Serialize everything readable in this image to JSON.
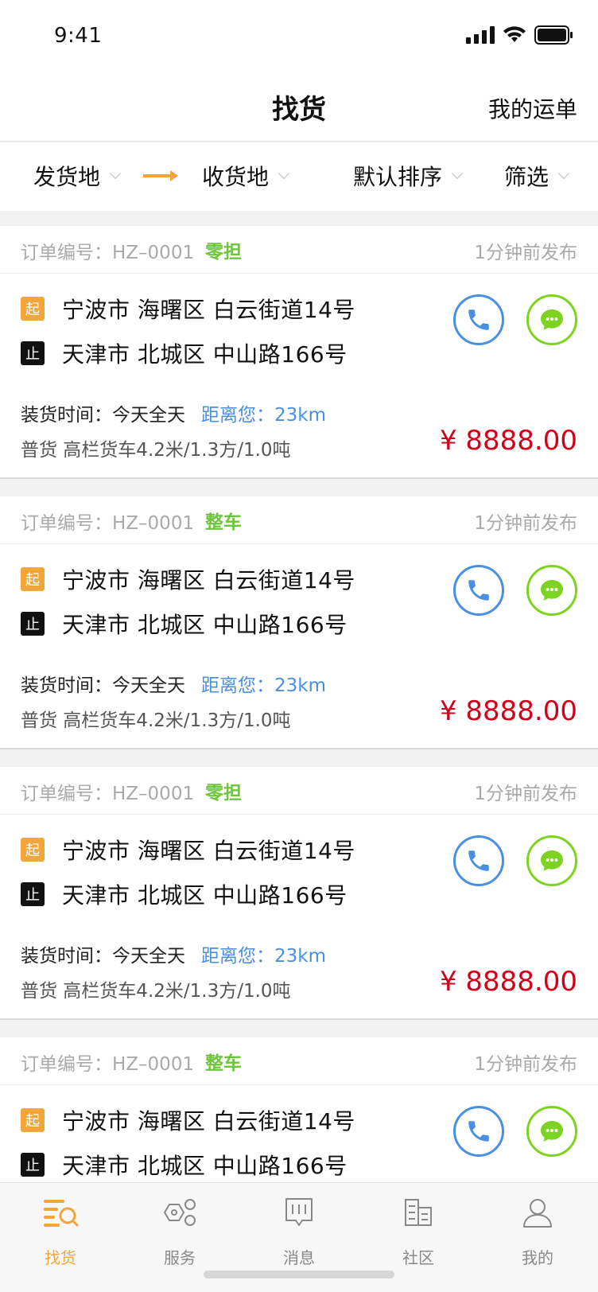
{
  "status": {
    "time": "9:41"
  },
  "header": {
    "title": "找货",
    "right_action": "我的运单"
  },
  "filters": {
    "origin": "发货地",
    "destination": "收货地",
    "sort": "默认排序",
    "filter": "筛选"
  },
  "orders": [
    {
      "order_label": "订单编号：HZ–0001",
      "tag": "零担",
      "posted": "1分钟前发布",
      "from_badge": "起",
      "from": "宁波市  海曙区  白云街道14号",
      "to_badge": "止",
      "to": "天津市  北城区  中山路166号",
      "load_time": "装货时间：今天全天",
      "distance": "距离您：23km",
      "goods": "普货  高栏货车4.2米/1.3方/1.0吨",
      "price": "¥ 8888.00"
    },
    {
      "order_label": "订单编号：HZ–0001",
      "tag": "整车",
      "posted": "1分钟前发布",
      "from_badge": "起",
      "from": "宁波市  海曙区  白云街道14号",
      "to_badge": "止",
      "to": "天津市  北城区  中山路166号",
      "load_time": "装货时间：今天全天",
      "distance": "距离您：23km",
      "goods": "普货  高栏货车4.2米/1.3方/1.0吨",
      "price": "¥ 8888.00"
    },
    {
      "order_label": "订单编号：HZ–0001",
      "tag": "零担",
      "posted": "1分钟前发布",
      "from_badge": "起",
      "from": "宁波市  海曙区  白云街道14号",
      "to_badge": "止",
      "to": "天津市  北城区  中山路166号",
      "load_time": "装货时间：今天全天",
      "distance": "距离您：23km",
      "goods": "普货  高栏货车4.2米/1.3方/1.0吨",
      "price": "¥ 8888.00"
    },
    {
      "order_label": "订单编号：HZ–0001",
      "tag": "整车",
      "posted": "1分钟前发布",
      "from_badge": "起",
      "from": "宁波市  海曙区  白云街道14号",
      "to_badge": "止",
      "to": "天津市  北城区  中山路166号"
    }
  ],
  "tabs": [
    {
      "label": "找货",
      "icon": "find-goods-icon",
      "active": true
    },
    {
      "label": "服务",
      "icon": "service-icon",
      "active": false
    },
    {
      "label": "消息",
      "icon": "message-icon",
      "active": false
    },
    {
      "label": "社区",
      "icon": "community-icon",
      "active": false
    },
    {
      "label": "我的",
      "icon": "profile-icon",
      "active": false
    }
  ],
  "colors": {
    "accent": "#f0a63a",
    "price": "#d0021b",
    "phone": "#4a90e2",
    "chat": "#7ed321",
    "tag": "#6dc53d"
  }
}
